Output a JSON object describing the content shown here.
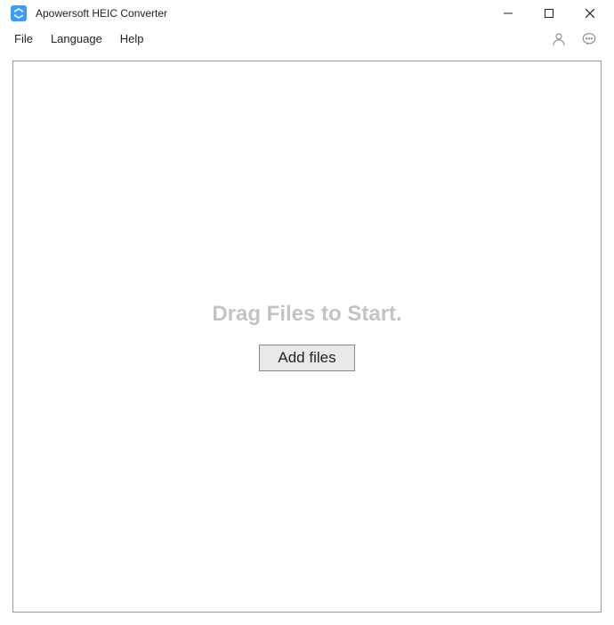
{
  "titlebar": {
    "app_title": "Apowersoft HEIC Converter"
  },
  "menubar": {
    "file_label": "File",
    "language_label": "Language",
    "help_label": "Help"
  },
  "main": {
    "drop_text": "Drag Files to Start.",
    "add_files_label": "Add files"
  }
}
